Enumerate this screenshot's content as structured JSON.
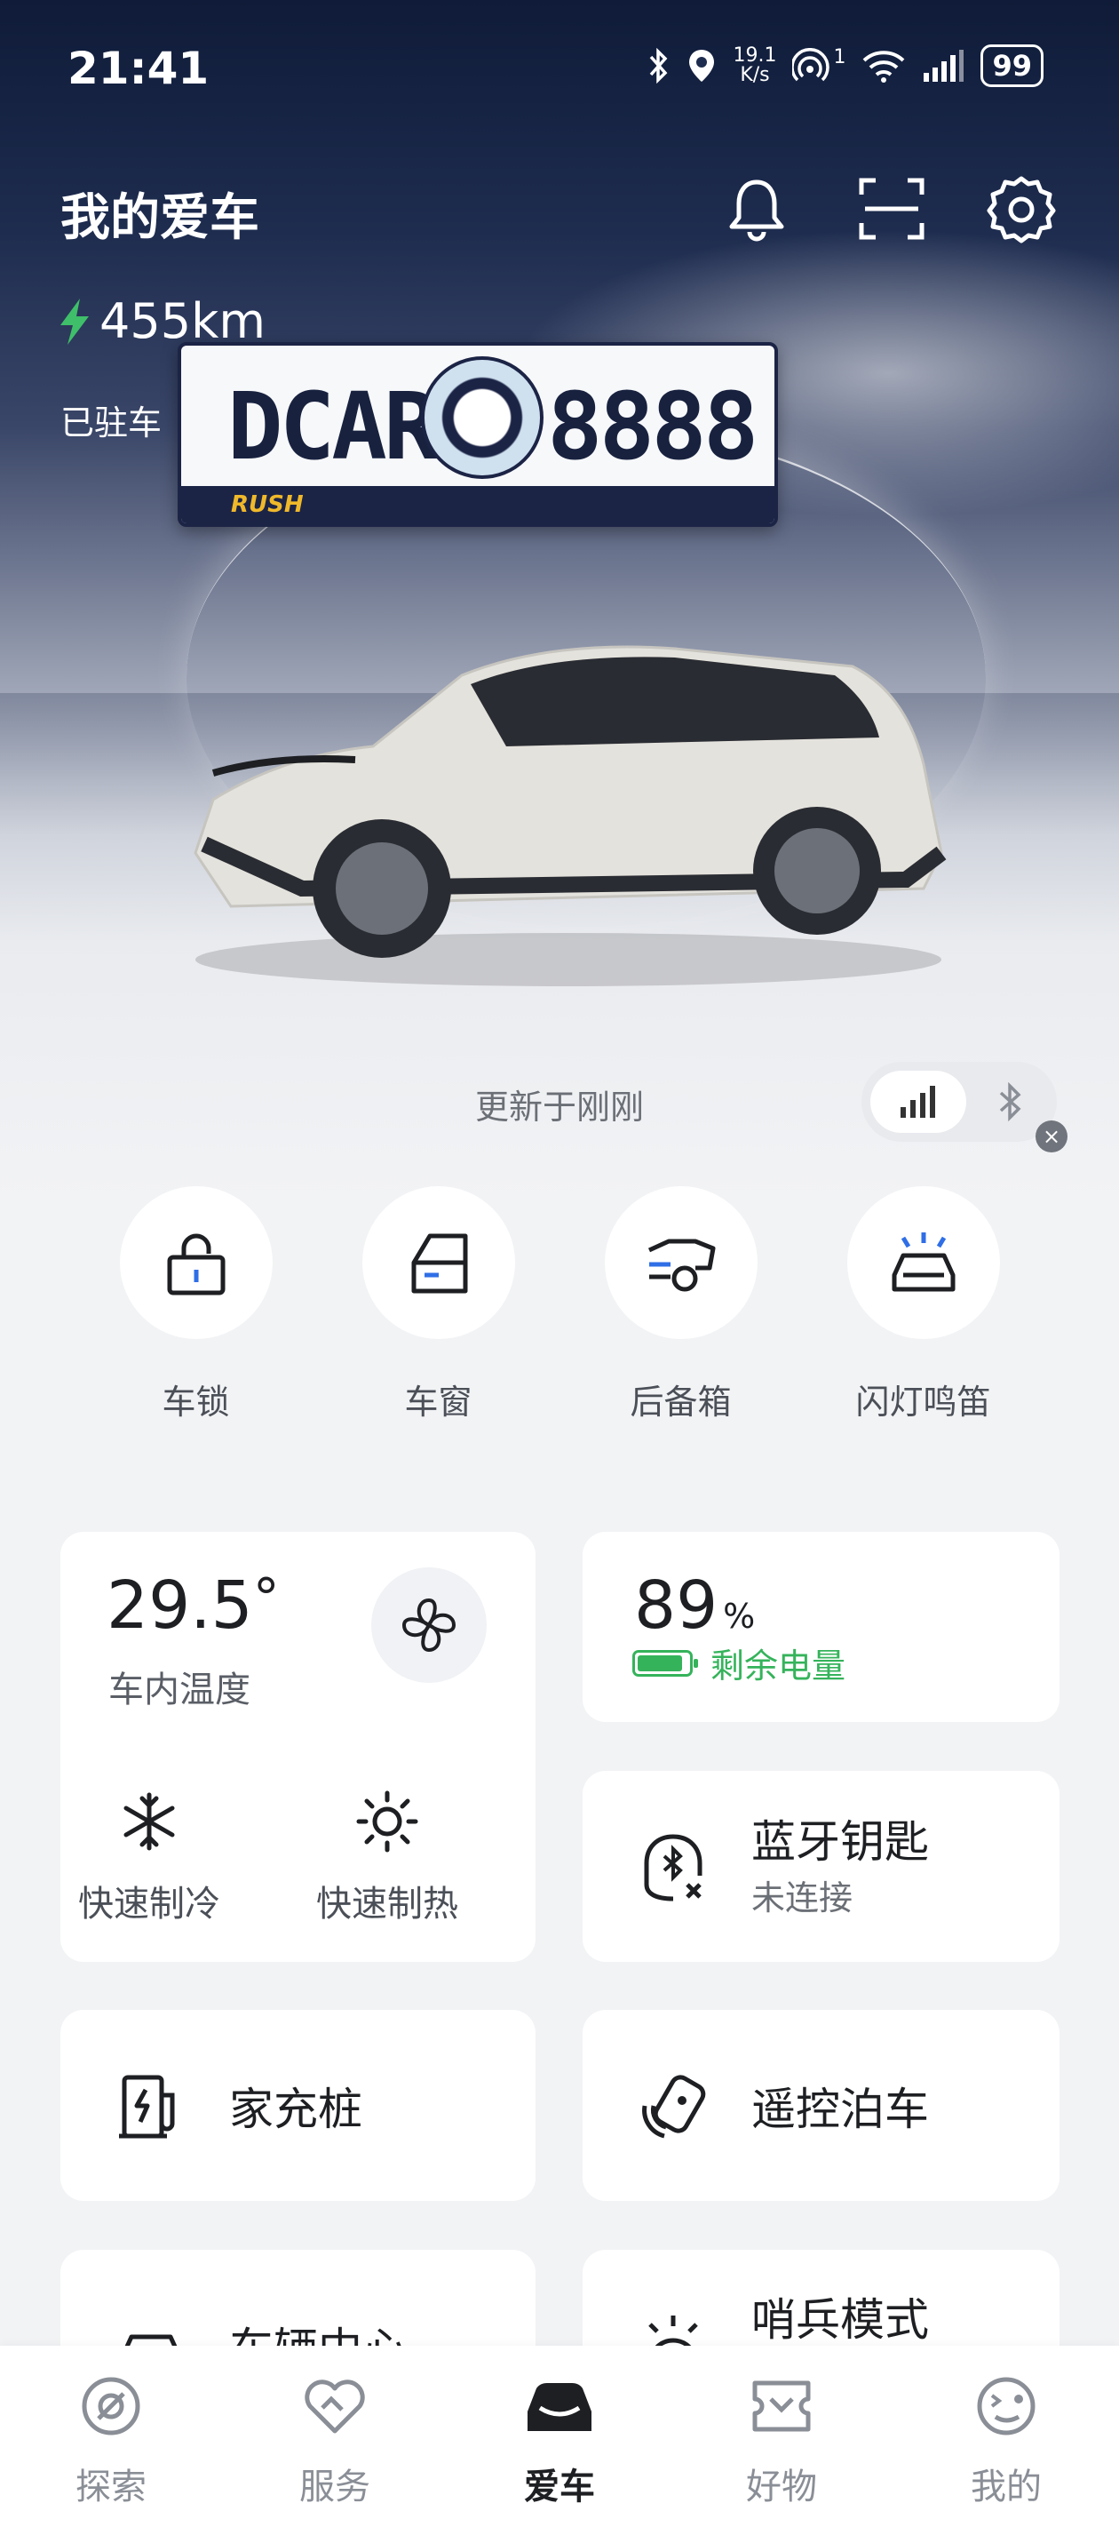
{
  "status_bar": {
    "time": "21:41",
    "net_speed": "19.1",
    "net_unit": "K/s",
    "hotspot_count": "1",
    "battery": "99"
  },
  "header": {
    "title": "我的爱车"
  },
  "vehicle": {
    "range": "455km",
    "status": "已驻车",
    "plate_left": "DCAR",
    "plate_right": "8888",
    "plate_brand": "RUSH"
  },
  "connection": {
    "updated": "更新于刚刚"
  },
  "quick_actions": [
    {
      "label": "车锁",
      "icon": "lock-icon"
    },
    {
      "label": "车窗",
      "icon": "window-icon"
    },
    {
      "label": "后备箱",
      "icon": "trunk-icon"
    },
    {
      "label": "闪灯鸣笛",
      "icon": "flash-horn-icon"
    }
  ],
  "climate": {
    "temperature": "29.5",
    "degree": "°",
    "label": "车内温度",
    "cool_label": "快速制冷",
    "heat_label": "快速制热"
  },
  "battery_card": {
    "percent": "89",
    "unit": "%",
    "label": "剩余电量",
    "level": 0.89,
    "color": "#35b35b"
  },
  "bluetooth_key": {
    "title": "蓝牙钥匙",
    "status": "未连接"
  },
  "features": {
    "home_charger": "家充桩",
    "remote_parking": "遥控泊车",
    "car_settings": "车辆中心",
    "sentry_mode": "哨兵模式"
  },
  "tabs": [
    {
      "label": "探索",
      "icon": "explore-icon"
    },
    {
      "label": "服务",
      "icon": "service-icon"
    },
    {
      "label": "爱车",
      "icon": "car-icon",
      "active": true
    },
    {
      "label": "好物",
      "icon": "shop-icon"
    },
    {
      "label": "我的",
      "icon": "profile-icon"
    }
  ]
}
